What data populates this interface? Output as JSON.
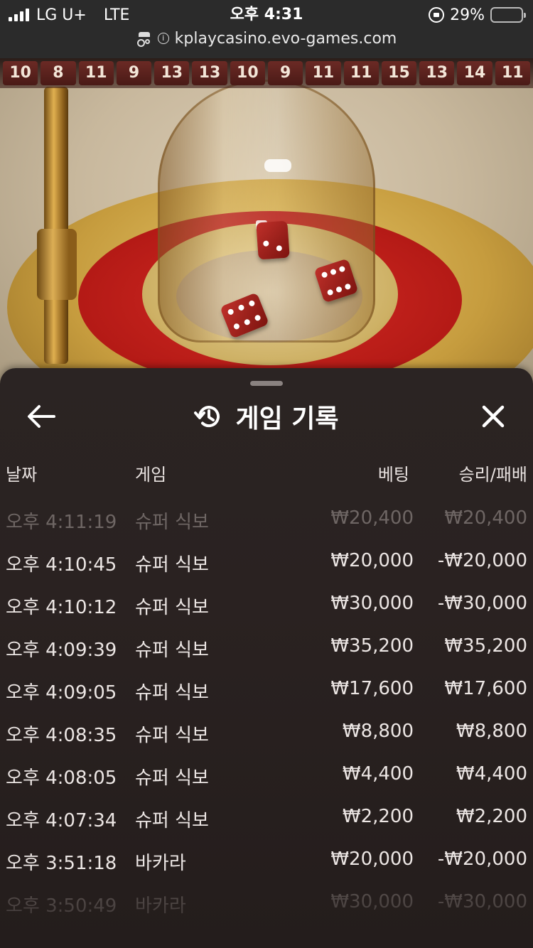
{
  "status_bar": {
    "carrier": "LG U+",
    "network": "LTE",
    "time": "오후 4:31",
    "battery_percent": "29%",
    "battery_level": 0.29,
    "battery_color": "#f2d02a",
    "url": "kplaycasino.evo-games.com"
  },
  "game": {
    "history_numbers": [
      "10",
      "8",
      "11",
      "9",
      "13",
      "13",
      "10",
      "9",
      "11",
      "11",
      "15",
      "13",
      "14",
      "11"
    ]
  },
  "sheet": {
    "title": "게임 기록",
    "icons": {
      "back": "arrow-left-icon",
      "history": "history-icon",
      "close": "close-icon"
    },
    "columns": {
      "date": "날짜",
      "game": "게임",
      "bet": "베팅",
      "result": "승리/패배"
    },
    "rows": [
      {
        "time": "오후 4:11:19",
        "game": "슈퍼 식보",
        "bet": "₩20,400",
        "result": "₩20,400"
      },
      {
        "time": "오후 4:10:45",
        "game": "슈퍼 식보",
        "bet": "₩20,000",
        "result": "-₩20,000"
      },
      {
        "time": "오후 4:10:12",
        "game": "슈퍼 식보",
        "bet": "₩30,000",
        "result": "-₩30,000"
      },
      {
        "time": "오후 4:09:39",
        "game": "슈퍼 식보",
        "bet": "₩35,200",
        "result": "₩35,200"
      },
      {
        "time": "오후 4:09:05",
        "game": "슈퍼 식보",
        "bet": "₩17,600",
        "result": "₩17,600"
      },
      {
        "time": "오후 4:08:35",
        "game": "슈퍼 식보",
        "bet": "₩8,800",
        "result": "₩8,800"
      },
      {
        "time": "오후 4:08:05",
        "game": "슈퍼 식보",
        "bet": "₩4,400",
        "result": "₩4,400"
      },
      {
        "time": "오후 4:07:34",
        "game": "슈퍼 식보",
        "bet": "₩2,200",
        "result": "₩2,200"
      },
      {
        "time": "오후 3:51:18",
        "game": "바카라",
        "bet": "₩20,000",
        "result": "-₩20,000"
      },
      {
        "time": "오후 3:50:49",
        "game": "바카라",
        "bet": "₩30,000",
        "result": "-₩30,000"
      }
    ]
  }
}
